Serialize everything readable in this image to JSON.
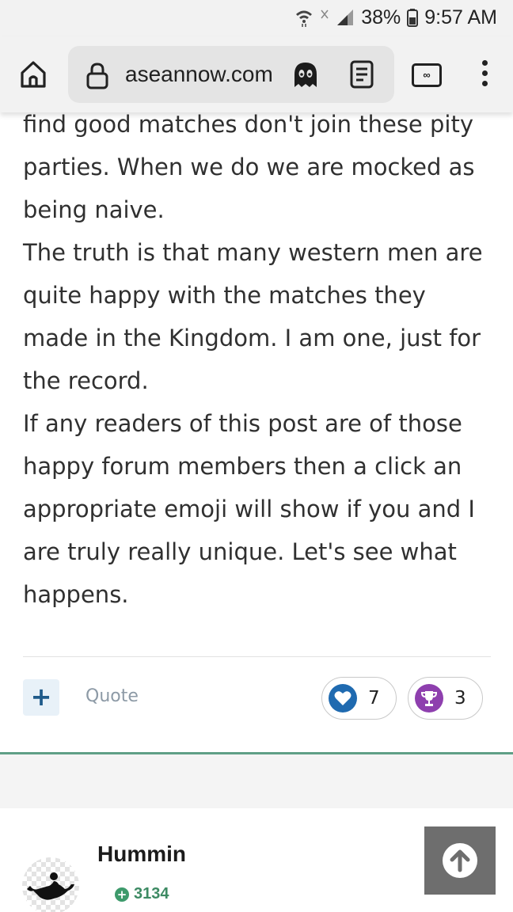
{
  "status_bar": {
    "battery_percent": "38%",
    "time": "9:57 AM"
  },
  "browser": {
    "url": "aseannow.com",
    "tabs_label": "∞"
  },
  "post": {
    "paragraphs": [
      "find good matches don't join these pity parties. When we do we are mocked as being naive.",
      "The truth is that many western men are quite happy with the matches they made in the Kingdom. I am one, just for the record.",
      "If any readers of this post are of those happy forum members then a click an appropriate emoji will show if you and I are truly really unique. Let's see what happens."
    ],
    "plus_label": "+",
    "quote_label": "Quote",
    "reactions": {
      "like_count": "7",
      "trophy_count": "3"
    }
  },
  "next_post": {
    "username": "Hummin",
    "reputation_sign": "+",
    "reputation": "3134"
  },
  "colors": {
    "accent_blue": "#1f6ab0",
    "trophy_purple": "#8e3fae",
    "reputation_green": "#3d9a6b",
    "divider_green": "#5f9f86"
  }
}
